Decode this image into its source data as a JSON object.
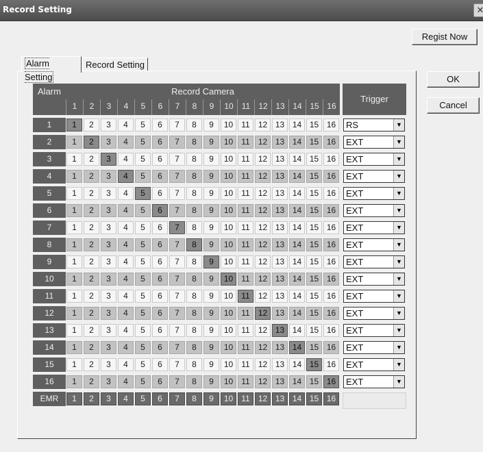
{
  "window": {
    "title": "Record Setting",
    "close_glyph": "✕"
  },
  "buttons": {
    "regist_now": "Regist Now",
    "ok": "OK",
    "cancel": "Cancel"
  },
  "tabs": [
    {
      "label": "Alarm Setting",
      "active": true
    },
    {
      "label": "Record Setting",
      "active": false
    }
  ],
  "table": {
    "header_alarm": "Alarm",
    "header_record_camera": "Record Camera",
    "header_trigger": "Trigger",
    "camera_numbers": [
      "1",
      "2",
      "3",
      "4",
      "5",
      "6",
      "7",
      "8",
      "9",
      "10",
      "11",
      "12",
      "13",
      "14",
      "15",
      "16"
    ],
    "rows": [
      {
        "label": "1",
        "trigger": "RS"
      },
      {
        "label": "2",
        "trigger": "EXT"
      },
      {
        "label": "3",
        "trigger": "EXT"
      },
      {
        "label": "4",
        "trigger": "EXT"
      },
      {
        "label": "5",
        "trigger": "EXT"
      },
      {
        "label": "6",
        "trigger": "EXT"
      },
      {
        "label": "7",
        "trigger": "EXT"
      },
      {
        "label": "8",
        "trigger": "EXT"
      },
      {
        "label": "9",
        "trigger": "EXT"
      },
      {
        "label": "10",
        "trigger": "EXT"
      },
      {
        "label": "11",
        "trigger": "EXT"
      },
      {
        "label": "12",
        "trigger": "EXT"
      },
      {
        "label": "13",
        "trigger": "EXT"
      },
      {
        "label": "14",
        "trigger": "EXT"
      },
      {
        "label": "15",
        "trigger": "EXT"
      },
      {
        "label": "16",
        "trigger": "EXT"
      }
    ],
    "emr_label": "EMR",
    "selected_camera_per_alarm_row": [
      1,
      2,
      3,
      4,
      5,
      6,
      7,
      8,
      9,
      10,
      11,
      12,
      13,
      14,
      15,
      16
    ],
    "emr_all_selected": true
  },
  "colors": {
    "header_bg": "#5f5f5f",
    "cell_light": "#f6f6f6",
    "cell_band": "#c2c2c2",
    "cell_selected": "#8a8a8a"
  },
  "icons": {
    "dropdown": "chevron-down-icon",
    "close": "close-icon"
  }
}
